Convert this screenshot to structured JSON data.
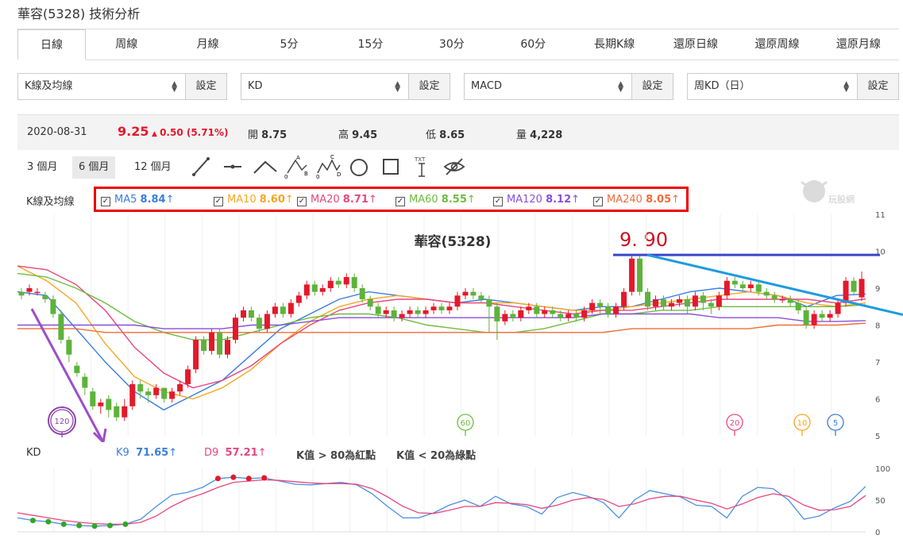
{
  "page_title": "華容(5328) 技術分析",
  "tabs": [
    "日線",
    "周線",
    "月線",
    "5分",
    "15分",
    "30分",
    "60分",
    "長期K線",
    "還原日線",
    "還原周線",
    "還原月線"
  ],
  "active_tab": "日線",
  "selectors": [
    {
      "value": "K線及均線",
      "button": "設定"
    },
    {
      "value": "KD",
      "button": "設定"
    },
    {
      "value": "MACD",
      "button": "設定"
    },
    {
      "value": "周KD（日）",
      "button": "設定"
    }
  ],
  "info": {
    "date": "2020-08-31",
    "price": "9.25",
    "change": "0.50 (5.71%)",
    "open_label": "開",
    "open": "8.75",
    "high_label": "高",
    "high": "9.45",
    "low_label": "低",
    "low": "8.65",
    "volume_label": "量",
    "volume": "4,228"
  },
  "range_buttons": [
    "3 個月",
    "6 個月",
    "12 個月"
  ],
  "active_range": "6 個月",
  "tool_icons": [
    "line-tool-icon",
    "horizontal-line-tool-icon",
    "angle-tool-icon",
    "abc-pattern-icon",
    "abcde-pattern-icon",
    "circle-tool-icon",
    "rectangle-tool-icon",
    "text-tool-icon",
    "hide-drawings-icon"
  ],
  "text_tool_label": "TXT",
  "watermark": "玩股網",
  "ma_section_label": "K線及均線",
  "ma_items": [
    {
      "name": "MA5",
      "value": "8.84",
      "arrow": "↑",
      "color": "#3b7ddd"
    },
    {
      "name": "MA10",
      "value": "8.60",
      "arrow": "↑",
      "color": "#f5a623"
    },
    {
      "name": "MA20",
      "value": "8.71",
      "arrow": "↑",
      "color": "#e8477e"
    },
    {
      "name": "MA60",
      "value": "8.55",
      "arrow": "↑",
      "color": "#6dbd3e"
    },
    {
      "name": "MA120",
      "value": "8.12",
      "arrow": "↑",
      "color": "#8a4fd8"
    },
    {
      "name": "MA240",
      "value": "8.05",
      "arrow": "↑",
      "color": "#f26b3a"
    }
  ],
  "chart_title": "華容(5328)",
  "annotation_price": "9. 90",
  "price_axis": [
    "11",
    "10",
    "9",
    "8",
    "7",
    "6",
    "5"
  ],
  "ma_markers": [
    {
      "label": "120",
      "color": "#8e44ad"
    },
    {
      "label": "60",
      "color": "#6dbd3e"
    },
    {
      "label": "20",
      "color": "#e8477e"
    },
    {
      "label": "10",
      "color": "#f5a623"
    },
    {
      "label": "5",
      "color": "#3b7ddd"
    }
  ],
  "kd": {
    "label": "KD",
    "k_label": "K9",
    "k_value": "71.65",
    "k_arrow": "↑",
    "d_label": "D9",
    "d_value": "57.21",
    "d_arrow": "↑",
    "rule_red": "K值 > 80為紅點",
    "rule_green": "K值 < 20為綠點",
    "axis": [
      "100",
      "50",
      "0"
    ]
  },
  "colors": {
    "up": "#e5182b",
    "down": "#5db33a",
    "k_line": "#4a90e2",
    "d_line": "#e8477e",
    "ann_blue": "#3a46c8",
    "ann_cyan": "#1e9be0",
    "ann_purple": "#9b4fc8"
  },
  "chart_data": {
    "type": "line",
    "title": "華容(5328)",
    "ylim": [
      5,
      11
    ],
    "ma_series": [
      {
        "name": "MA5",
        "values": [
          8.9,
          8.8,
          7.9,
          7.0,
          6.2,
          5.7,
          6.1,
          6.5,
          7.2,
          7.9,
          8.3,
          8.7,
          8.9,
          8.8,
          8.7,
          8.6,
          8.7,
          8.6,
          8.5,
          8.4,
          8.5,
          8.5,
          8.7,
          8.9,
          9.0,
          8.9,
          8.8,
          8.5,
          8.8,
          8.84
        ]
      },
      {
        "name": "MA10",
        "values": [
          9.6,
          9.2,
          8.6,
          7.5,
          6.6,
          6.2,
          6.0,
          6.3,
          6.8,
          7.5,
          8.1,
          8.5,
          8.7,
          8.8,
          8.7,
          8.6,
          8.6,
          8.6,
          8.5,
          8.4,
          8.4,
          8.5,
          8.6,
          8.7,
          8.8,
          8.9,
          8.8,
          8.6,
          8.5,
          8.6
        ]
      },
      {
        "name": "MA20",
        "values": [
          9.6,
          9.5,
          9.1,
          8.4,
          7.4,
          6.7,
          6.3,
          6.5,
          6.9,
          7.5,
          8.0,
          8.4,
          8.6,
          8.7,
          8.7,
          8.6,
          8.6,
          8.5,
          8.4,
          8.3,
          8.4,
          8.4,
          8.5,
          8.6,
          8.7,
          8.7,
          8.7,
          8.7,
          8.6,
          8.71
        ]
      },
      {
        "name": "MA60",
        "values": [
          9.4,
          9.3,
          9.0,
          8.6,
          8.1,
          7.8,
          7.6,
          7.6,
          7.8,
          8.0,
          8.2,
          8.3,
          8.3,
          8.2,
          8.0,
          7.9,
          7.8,
          7.8,
          7.9,
          8.1,
          8.3,
          8.3,
          8.4,
          8.4,
          8.5,
          8.5,
          8.5,
          8.5,
          8.5,
          8.55
        ]
      },
      {
        "name": "MA120",
        "values": [
          8.0,
          8.0,
          8.0,
          8.0,
          8.0,
          7.9,
          7.9,
          7.9,
          8.0,
          8.0,
          8.1,
          8.2,
          8.2,
          8.2,
          8.2,
          8.2,
          8.2,
          8.2,
          8.2,
          8.2,
          8.3,
          8.3,
          8.3,
          8.3,
          8.2,
          8.2,
          8.2,
          8.1,
          8.1,
          8.12
        ]
      },
      {
        "name": "MA240",
        "values": [
          7.9,
          7.9,
          7.9,
          7.8,
          7.8,
          7.8,
          7.8,
          7.8,
          7.8,
          7.8,
          7.8,
          7.8,
          7.8,
          7.8,
          7.8,
          7.8,
          7.8,
          7.8,
          7.8,
          7.8,
          7.8,
          7.9,
          7.9,
          7.9,
          7.9,
          7.9,
          8.0,
          8.0,
          8.0,
          8.05
        ]
      }
    ],
    "candles": [
      [
        8.9,
        8.8,
        9.0,
        8.7
      ],
      [
        8.9,
        9.0,
        9.1,
        8.8
      ],
      [
        8.9,
        8.9,
        9.0,
        8.8
      ],
      [
        8.8,
        8.7,
        8.9,
        8.6
      ],
      [
        8.7,
        8.3,
        8.8,
        8.2
      ],
      [
        8.3,
        7.6,
        8.4,
        7.5
      ],
      [
        7.6,
        7.2,
        7.7,
        7.0
      ],
      [
        6.9,
        6.7,
        7.0,
        6.6
      ],
      [
        6.6,
        6.3,
        6.7,
        6.1
      ],
      [
        6.2,
        5.8,
        6.3,
        5.7
      ],
      [
        5.8,
        5.9,
        6.0,
        5.6
      ],
      [
        6.0,
        5.7,
        6.1,
        5.5
      ],
      [
        5.8,
        5.5,
        5.9,
        5.4
      ],
      [
        5.5,
        5.8,
        6.0,
        5.4
      ],
      [
        5.8,
        6.4,
        6.5,
        5.7
      ],
      [
        6.4,
        6.2,
        6.5,
        6.0
      ],
      [
        6.2,
        6.1,
        6.3,
        5.9
      ],
      [
        6.1,
        6.3,
        6.4,
        6.0
      ],
      [
        6.3,
        6.0,
        6.3,
        5.9
      ],
      [
        6.0,
        6.2,
        6.3,
        5.9
      ],
      [
        6.2,
        6.4,
        6.5,
        6.1
      ],
      [
        6.4,
        6.8,
        6.9,
        6.3
      ],
      [
        6.8,
        7.6,
        7.7,
        6.7
      ],
      [
        7.6,
        7.3,
        7.7,
        7.2
      ],
      [
        7.3,
        7.8,
        7.9,
        7.2
      ],
      [
        7.8,
        7.2,
        7.9,
        7.1
      ],
      [
        7.2,
        7.6,
        7.7,
        7.1
      ],
      [
        7.6,
        8.2,
        8.3,
        7.5
      ],
      [
        8.2,
        8.4,
        8.5,
        8.1
      ],
      [
        8.4,
        8.2,
        8.5,
        8.1
      ],
      [
        8.2,
        7.9,
        8.3,
        7.8
      ],
      [
        7.9,
        8.3,
        8.4,
        7.8
      ],
      [
        8.3,
        8.5,
        8.6,
        8.2
      ],
      [
        8.5,
        8.3,
        8.6,
        8.2
      ],
      [
        8.3,
        8.6,
        8.7,
        8.2
      ],
      [
        8.6,
        8.8,
        8.9,
        8.5
      ],
      [
        8.8,
        9.1,
        9.2,
        8.7
      ],
      [
        9.1,
        8.9,
        9.2,
        8.8
      ],
      [
        8.9,
        9.0,
        9.1,
        8.8
      ],
      [
        9.0,
        9.2,
        9.3,
        8.9
      ],
      [
        9.2,
        9.1,
        9.3,
        9.0
      ],
      [
        9.1,
        9.3,
        9.4,
        9.0
      ],
      [
        9.3,
        9.0,
        9.4,
        8.9
      ],
      [
        9.0,
        8.7,
        9.1,
        8.6
      ],
      [
        8.7,
        8.5,
        8.8,
        8.4
      ],
      [
        8.5,
        8.3,
        8.6,
        8.2
      ],
      [
        8.3,
        8.4,
        8.5,
        8.2
      ],
      [
        8.4,
        8.2,
        8.5,
        8.1
      ],
      [
        8.2,
        8.3,
        8.4,
        8.1
      ],
      [
        8.3,
        8.4,
        8.5,
        8.2
      ],
      [
        8.4,
        8.3,
        8.5,
        8.2
      ],
      [
        8.3,
        8.4,
        8.5,
        8.2
      ],
      [
        8.4,
        8.5,
        8.6,
        8.3
      ],
      [
        8.5,
        8.4,
        8.6,
        8.3
      ],
      [
        8.4,
        8.5,
        8.6,
        8.3
      ],
      [
        8.5,
        8.8,
        8.9,
        8.4
      ],
      [
        8.8,
        8.9,
        9.0,
        8.7
      ],
      [
        8.9,
        8.8,
        9.0,
        8.7
      ],
      [
        8.8,
        8.7,
        8.9,
        8.6
      ],
      [
        8.7,
        8.5,
        8.8,
        7.8
      ],
      [
        8.5,
        8.1,
        8.6,
        7.6
      ],
      [
        8.1,
        8.3,
        8.4,
        8.0
      ],
      [
        8.3,
        8.2,
        8.4,
        8.1
      ],
      [
        8.2,
        8.4,
        8.5,
        8.1
      ],
      [
        8.4,
        8.5,
        8.6,
        8.3
      ],
      [
        8.5,
        8.3,
        8.6,
        8.2
      ],
      [
        8.3,
        8.4,
        8.5,
        8.2
      ],
      [
        8.4,
        8.3,
        8.5,
        8.2
      ],
      [
        8.3,
        8.2,
        8.4,
        8.1
      ],
      [
        8.2,
        8.3,
        8.4,
        8.1
      ],
      [
        8.3,
        8.2,
        8.4,
        8.1
      ],
      [
        8.2,
        8.4,
        8.5,
        8.1
      ],
      [
        8.4,
        8.6,
        8.7,
        8.3
      ],
      [
        8.6,
        8.5,
        8.7,
        8.3
      ],
      [
        8.5,
        8.3,
        8.6,
        8.2
      ],
      [
        8.3,
        8.5,
        8.6,
        8.2
      ],
      [
        8.5,
        8.9,
        9.0,
        8.4
      ],
      [
        8.9,
        9.8,
        9.9,
        8.8
      ],
      [
        9.8,
        8.9,
        9.9,
        8.8
      ],
      [
        8.9,
        8.5,
        9.0,
        8.4
      ],
      [
        8.5,
        8.7,
        8.8,
        8.4
      ],
      [
        8.7,
        8.5,
        8.8,
        8.4
      ],
      [
        8.5,
        8.6,
        8.7,
        8.4
      ],
      [
        8.6,
        8.7,
        8.8,
        8.5
      ],
      [
        8.7,
        8.5,
        8.8,
        8.3
      ],
      [
        8.5,
        8.8,
        8.9,
        8.4
      ],
      [
        8.8,
        8.6,
        8.9,
        8.4
      ],
      [
        8.6,
        8.5,
        8.7,
        8.3
      ],
      [
        8.5,
        8.8,
        8.9,
        8.4
      ],
      [
        8.8,
        9.2,
        9.3,
        8.7
      ],
      [
        9.2,
        9.1,
        9.3,
        9.0
      ],
      [
        9.1,
        9.0,
        9.2,
        8.9
      ],
      [
        9.0,
        9.1,
        9.2,
        8.9
      ],
      [
        9.1,
        8.9,
        9.2,
        8.8
      ],
      [
        8.9,
        8.8,
        9.0,
        8.7
      ],
      [
        8.8,
        8.7,
        8.9,
        8.6
      ],
      [
        8.7,
        8.7,
        8.8,
        8.6
      ],
      [
        8.7,
        8.6,
        8.8,
        8.5
      ],
      [
        8.6,
        8.4,
        8.7,
        8.3
      ],
      [
        8.4,
        8.0,
        8.5,
        7.9
      ],
      [
        8.0,
        8.3,
        8.4,
        7.9
      ],
      [
        8.3,
        8.2,
        8.4,
        8.1
      ],
      [
        8.2,
        8.3,
        8.4,
        8.1
      ],
      [
        8.3,
        8.6,
        8.7,
        8.2
      ],
      [
        8.6,
        9.2,
        9.3,
        8.5
      ],
      [
        9.2,
        8.9,
        9.3,
        8.8
      ],
      [
        8.75,
        9.25,
        9.45,
        8.65
      ]
    ],
    "kd_series": [
      {
        "name": "K9",
        "values": [
          22,
          18,
          16,
          12,
          10,
          9,
          10,
          12,
          20,
          40,
          58,
          62,
          70,
          84,
          86,
          84,
          85,
          80,
          75,
          74,
          76,
          78,
          74,
          60,
          40,
          22,
          22,
          30,
          42,
          50,
          40,
          56,
          44,
          40,
          28,
          54,
          62,
          56,
          46,
          22,
          50,
          65,
          60,
          55,
          42,
          40,
          22,
          56,
          70,
          68,
          50,
          20,
          25,
          38,
          48,
          71.65
        ]
      },
      {
        "name": "D9",
        "values": [
          30,
          26,
          22,
          18,
          15,
          13,
          12,
          12,
          15,
          25,
          40,
          52,
          60,
          70,
          78,
          80,
          82,
          81,
          79,
          77,
          76,
          76,
          75,
          68,
          55,
          40,
          30,
          29,
          34,
          40,
          40,
          46,
          45,
          43,
          37,
          42,
          50,
          54,
          51,
          40,
          44,
          52,
          56,
          56,
          50,
          45,
          36,
          44,
          54,
          60,
          56,
          42,
          34,
          35,
          40,
          57.21
        ]
      }
    ]
  }
}
